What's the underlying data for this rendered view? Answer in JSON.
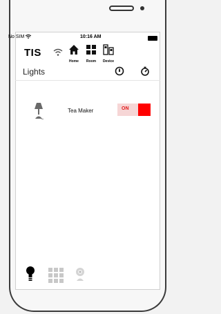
{
  "status_bar": {
    "carrier": "No SIM",
    "time": "10:16 AM"
  },
  "header": {
    "logo": "TIS",
    "nav": [
      {
        "label": "Home",
        "icon": "home-icon"
      },
      {
        "label": "Room",
        "icon": "grid-icon"
      },
      {
        "label": "Device",
        "icon": "device-icon"
      }
    ]
  },
  "page": {
    "title": "Lights",
    "header_icons": [
      "gauge-icon",
      "timer-icon"
    ]
  },
  "devices": [
    {
      "name": "Tea Maker",
      "state": "ON",
      "icon": "lamp-icon"
    }
  ],
  "bottom_tabs": [
    {
      "icon": "bulb-icon",
      "active": true
    },
    {
      "icon": "grid-icon",
      "active": false
    },
    {
      "icon": "webcam-icon",
      "active": false
    }
  ],
  "colors": {
    "accent": "#ff0000",
    "toggle_bg": "#f6d6d6",
    "on_text": "#e21c1c"
  }
}
